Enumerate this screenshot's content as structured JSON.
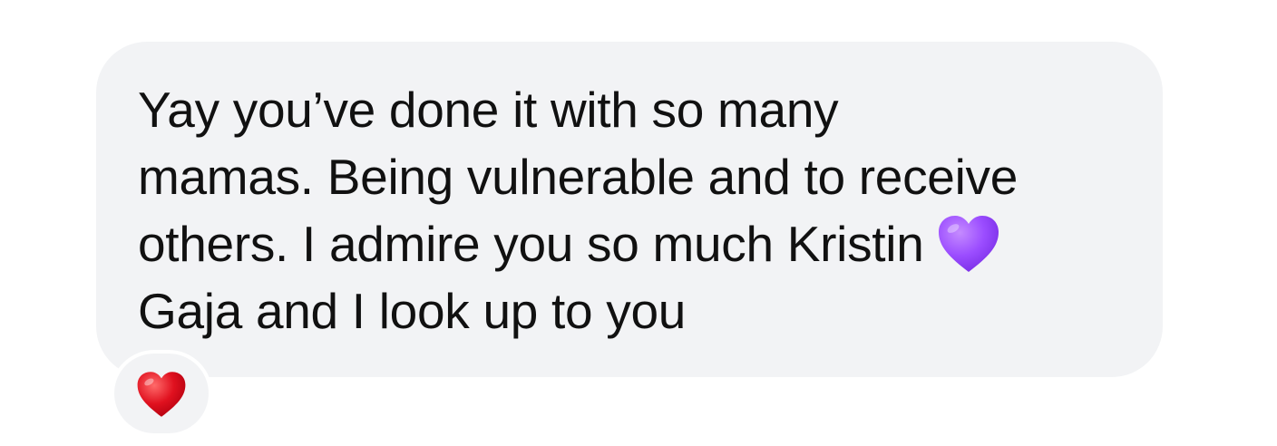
{
  "message": {
    "lines": [
      "Yay you’ve done it with so many",
      "mamas. Being vulnerable and to receive",
      "others. I admire you so much Kristin",
      "Gaja and I look up to you"
    ],
    "inline_emoji": "purple-heart-icon",
    "bubble_color": "#f2f3f5",
    "text_color": "#111111"
  },
  "reaction": {
    "emoji": "red-heart-icon",
    "color": "#e0111f"
  },
  "colors": {
    "purple_heart": "#9b4dff",
    "red_heart": "#e0111f"
  }
}
